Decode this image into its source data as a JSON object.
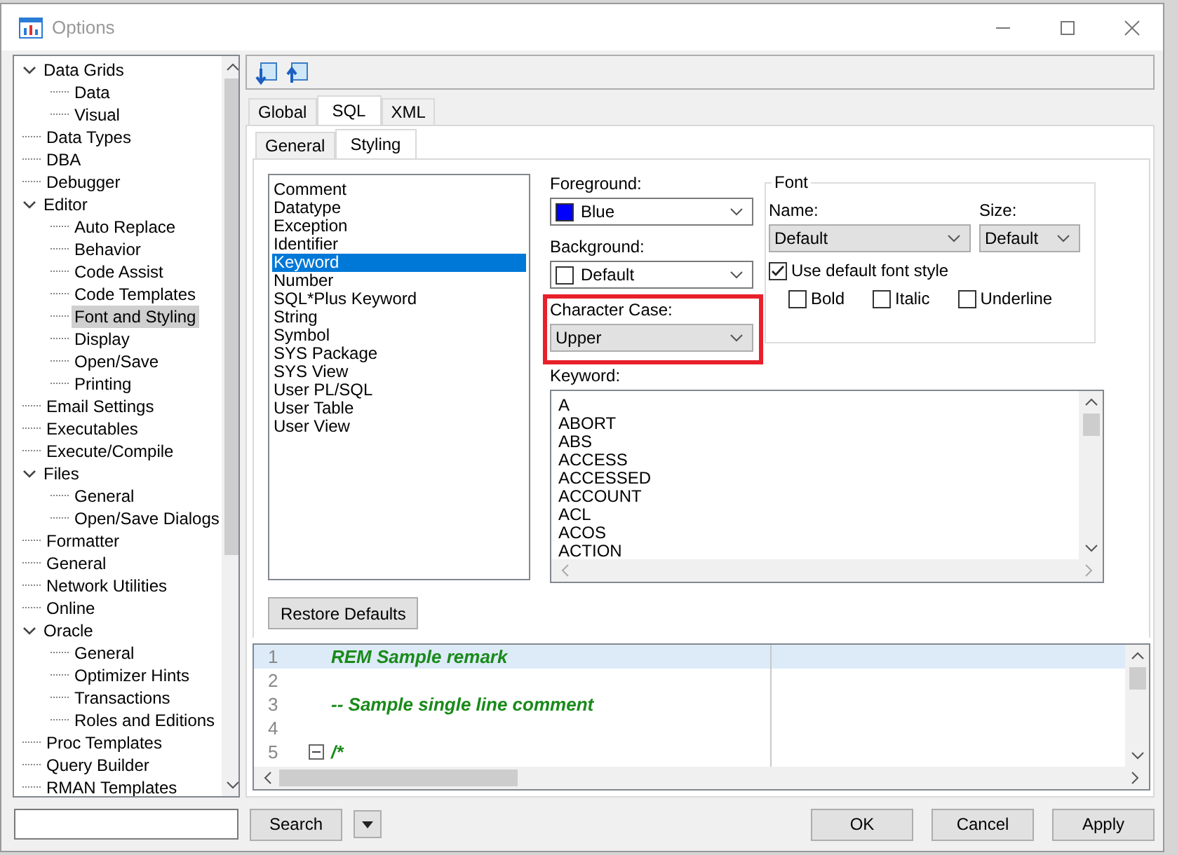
{
  "window": {
    "title": "Options"
  },
  "tree": [
    {
      "label": "Data Grids",
      "expanded": true,
      "selected": false,
      "children": [
        {
          "label": "Data",
          "selected": false
        },
        {
          "label": "Visual",
          "selected": false
        }
      ]
    },
    {
      "label": "Data Types",
      "selected": false
    },
    {
      "label": "DBA",
      "selected": false
    },
    {
      "label": "Debugger",
      "selected": false
    },
    {
      "label": "Editor",
      "expanded": true,
      "selected": false,
      "children": [
        {
          "label": "Auto Replace",
          "selected": false
        },
        {
          "label": "Behavior",
          "selected": false
        },
        {
          "label": "Code Assist",
          "selected": false
        },
        {
          "label": "Code Templates",
          "selected": false
        },
        {
          "label": "Font and Styling",
          "selected": true
        },
        {
          "label": "Display",
          "selected": false
        },
        {
          "label": "Open/Save",
          "selected": false
        },
        {
          "label": "Printing",
          "selected": false
        }
      ]
    },
    {
      "label": "Email Settings",
      "selected": false
    },
    {
      "label": "Executables",
      "selected": false
    },
    {
      "label": "Execute/Compile",
      "selected": false
    },
    {
      "label": "Files",
      "expanded": true,
      "selected": false,
      "children": [
        {
          "label": "General",
          "selected": false
        },
        {
          "label": "Open/Save Dialogs",
          "selected": false
        }
      ]
    },
    {
      "label": "Formatter",
      "selected": false
    },
    {
      "label": "General",
      "selected": false
    },
    {
      "label": "Network Utilities",
      "selected": false
    },
    {
      "label": "Online",
      "selected": false
    },
    {
      "label": "Oracle",
      "expanded": true,
      "selected": false,
      "children": [
        {
          "label": "General",
          "selected": false
        },
        {
          "label": "Optimizer Hints",
          "selected": false
        },
        {
          "label": "Transactions",
          "selected": false
        },
        {
          "label": "Roles and Editions",
          "selected": false
        }
      ]
    },
    {
      "label": "Proc Templates",
      "selected": false
    },
    {
      "label": "Query Builder",
      "selected": false
    },
    {
      "label": "RMAN Templates",
      "selected": false
    }
  ],
  "tabs": [
    {
      "label": "Global",
      "selected": false
    },
    {
      "label": "SQL",
      "selected": true
    },
    {
      "label": "XML",
      "selected": false
    }
  ],
  "subtabs": [
    {
      "label": "General",
      "selected": false
    },
    {
      "label": "Styling",
      "selected": true
    }
  ],
  "elements": [
    {
      "label": "Comment",
      "selected": false
    },
    {
      "label": "Datatype",
      "selected": false
    },
    {
      "label": "Exception",
      "selected": false
    },
    {
      "label": "Identifier",
      "selected": false
    },
    {
      "label": "Keyword",
      "selected": true
    },
    {
      "label": "Number",
      "selected": false
    },
    {
      "label": "SQL*Plus Keyword",
      "selected": false
    },
    {
      "label": "String",
      "selected": false
    },
    {
      "label": "Symbol",
      "selected": false
    },
    {
      "label": "SYS Package",
      "selected": false
    },
    {
      "label": "SYS View",
      "selected": false
    },
    {
      "label": "User PL/SQL",
      "selected": false
    },
    {
      "label": "User Table",
      "selected": false
    },
    {
      "label": "User View",
      "selected": false
    }
  ],
  "foreground": {
    "label": "Foreground:",
    "value": "Blue",
    "color": "#0000ff"
  },
  "background": {
    "label": "Background:",
    "value": "Default",
    "color": "#ffffff"
  },
  "character_case": {
    "label": "Character Case:",
    "value": "Upper",
    "highlighted": true
  },
  "font": {
    "title": "Font",
    "name_label": "Name:",
    "name_value": "Default",
    "size_label": "Size:",
    "size_value": "Default",
    "use_default": {
      "label": "Use default font style",
      "checked": true
    },
    "styles": [
      {
        "label": "Bold",
        "checked": false
      },
      {
        "label": "Italic",
        "checked": false
      },
      {
        "label": "Underline",
        "checked": false
      }
    ]
  },
  "keywords": {
    "label": "Keyword:",
    "items": [
      "A",
      "ABORT",
      "ABS",
      "ACCESS",
      "ACCESSED",
      "ACCOUNT",
      "ACL",
      "ACOS",
      "ACTION"
    ]
  },
  "restore_button": "Restore Defaults",
  "editor": [
    {
      "number": "1",
      "text": "REM Sample remark",
      "current": true
    },
    {
      "number": "2",
      "current": false
    },
    {
      "number": "3",
      "text": "-- Sample single line comment",
      "current": false
    },
    {
      "number": "4",
      "current": false
    },
    {
      "number": "5",
      "text": "/*",
      "current": false,
      "fold": true
    }
  ],
  "search_button": "Search",
  "buttons": [
    "OK",
    "Cancel",
    "Apply"
  ]
}
